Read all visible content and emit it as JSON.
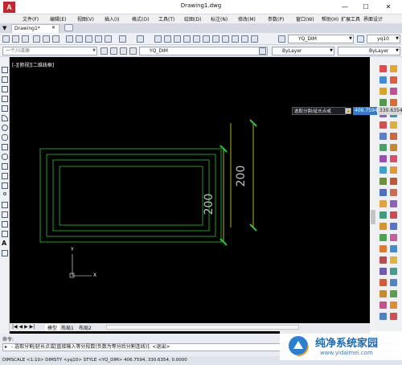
{
  "window": {
    "title": "Drawing1.dwg",
    "app_logo_text": "A",
    "controls": {
      "minimize": "—",
      "maximize": "☐",
      "close": "✕"
    }
  },
  "menubar": {
    "items": [
      "文件(F)",
      "编辑(E)",
      "视图(V)",
      "插入(I)",
      "格式(O)",
      "工具(T)",
      "绘图(D)",
      "标注(N)",
      "修改(M)",
      "参数(P)",
      "窗口(W)",
      "帮助(H)",
      "扩展工具",
      "界面设计"
    ]
  },
  "tabs": {
    "active": "Drawing1*"
  },
  "toolbar": {
    "dimstyle": "YQ_DIM",
    "textstyle": "yq10"
  },
  "properties_bar": {
    "layer_hint": "一个川泽原",
    "layer": "YQ_DIM",
    "color": "ByLayer",
    "linetype": "ByLayer"
  },
  "canvas": {
    "viewport_label": "[-][俯视][二维线框]",
    "dimension_text_1": "200",
    "dimension_text_2": "200",
    "ucs_y": "Y",
    "ucs_x": "X"
  },
  "dynamic_prompt": {
    "prompt": "选取分割/延长点或",
    "lock_glyph": "🔒",
    "value_1": "406.7594",
    "value_2": "330.6354"
  },
  "layout_tabs": [
    "模型",
    "布局1",
    "布局2"
  ],
  "command": {
    "history_label": "命令:",
    "input_text": "- 选取分割/延长点或[直接输入等分段数(负数为等分后分割连线)]: <退出>"
  },
  "statusbar": {
    "text": "DIMSCALE <1:10> DIMSTY <yq10> STYLE <YQ_DIM>  406.7594, 330.6354, 0.0000"
  },
  "watermark": {
    "title": "纯净系统家园",
    "url": "www.yidaimei.com"
  },
  "colors": {
    "canvas_bg": "#000000",
    "geometry": "#2fbf2f",
    "dimension_line": "#d6e61c",
    "dimension_text": "#bfbfbf",
    "accent_logo": "#c4262e"
  }
}
